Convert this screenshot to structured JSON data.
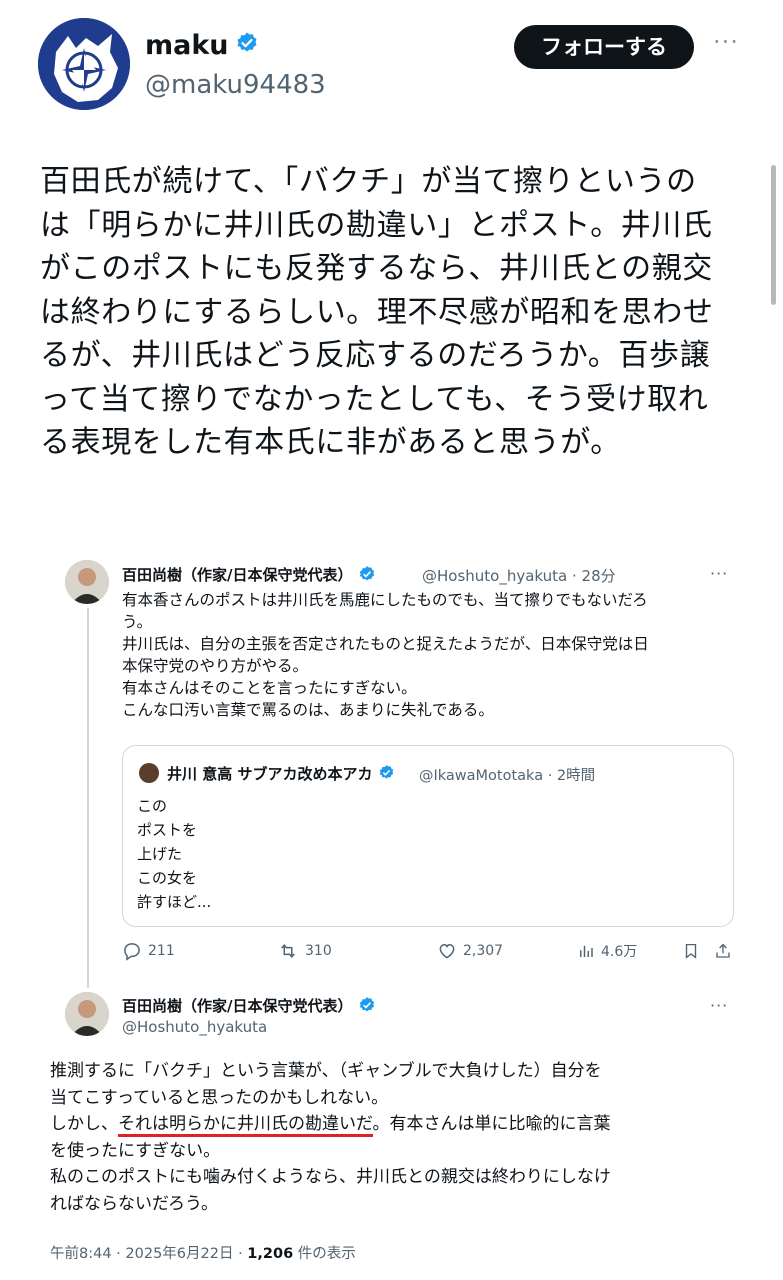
{
  "author": {
    "name": "maku",
    "handle": "@maku94483",
    "follow_label": "フォローする",
    "more_label": "···"
  },
  "tweet": {
    "lines": [
      "百田氏が続けて、「バクチ」が当て擦りというの",
      "は「明らかに井川氏の勘違い」とポスト。井川氏",
      "がこのポストにも反発するなら、井川氏との親交",
      "は終わりにするらしい。理不尽感が昭和を思わせ",
      "るが、井川氏はどう反応するのだろうか。百歩譲",
      "って当て擦りでなかったとしても、そう受け取れ",
      "る表現をした有本氏に非があると思うが。"
    ]
  },
  "embedded": {
    "post1": {
      "name": "百田尚樹（作家/日本保守党代表）",
      "meta": "@Hoshuto_hyakuta · 28分",
      "more": "···",
      "lines": [
        "有本香さんのポストは井川氏を馬鹿にしたものでも、当て擦りでもないだろ",
        "う。",
        "井川氏は、自分の主張を否定されたものと捉えたようだが、日本保守党は日",
        "本保守党のやり方がやる。",
        "有本さんはそのことを言ったにすぎない。",
        "こんな口汚い言葉で罵るのは、あまりに失礼である。"
      ],
      "quote": {
        "name": "井川 意高 サブアカ改め本アカ",
        "meta": "@IkawaMototaka · 2時間",
        "lines": [
          "この",
          "ポストを",
          "上げた",
          "この女を",
          "許すほど..."
        ]
      },
      "actions": {
        "replies": "211",
        "reposts": "310",
        "likes": "2,307",
        "views": "4.6万"
      }
    },
    "post2": {
      "name": "百田尚樹（作家/日本保守党代表）",
      "handle": "@Hoshuto_hyakuta",
      "more": "···",
      "line1": "推測するに「バクチ」という言葉が、（ギャンブルで大負けした）自分を",
      "line2": "当てこすっていると思ったのかもしれない。",
      "line3_pre": "しかし、",
      "line3_underlined": "それは明らかに井川氏の勘違いだ",
      "line3_post": "。有本さんは単に比喩的に言葉",
      "line4": "を使ったにすぎない。",
      "line5": "私のこのポストにも噛み付くようなら、井川氏との親交は終わりにしなけ",
      "line6": "ればならないだろう。",
      "footer_time": "午前8:44 · 2025年6月22日 · ",
      "footer_views": "1,206",
      "footer_suffix": " 件の表示"
    }
  },
  "colors": {
    "verified": "#1d9bf0",
    "underline": "#e0202a",
    "secondary": "#536471"
  },
  "icons": [
    "nato-star-avatar",
    "verified-badge",
    "reply-icon",
    "repost-icon",
    "like-icon",
    "views-icon",
    "bookmark-icon",
    "share-icon"
  ]
}
